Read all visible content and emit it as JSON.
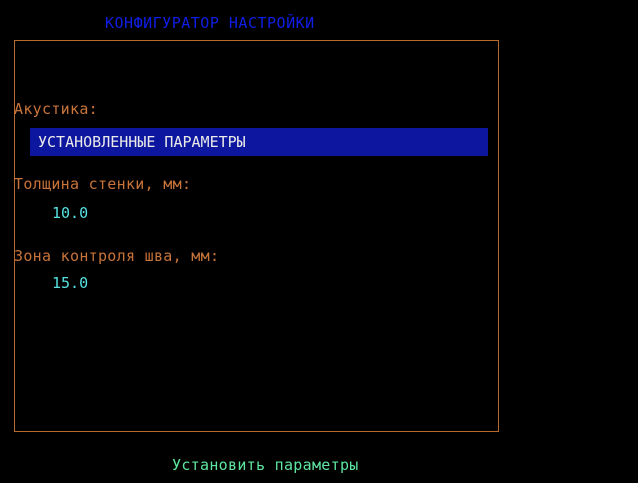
{
  "window": {
    "title": "КОНФИГУРАТОР НАСТРОЙКИ"
  },
  "form": {
    "acoustics": {
      "label": "Акустика:",
      "value": "УСТАНОВЛЕННЫЕ ПАРАМЕТРЫ"
    },
    "wall_thickness": {
      "label": "Толщина стенки, мм:",
      "value": "10.0"
    },
    "seam_zone": {
      "label": "Зона контроля шва, мм:",
      "value": "15.0"
    }
  },
  "footer": {
    "action_label": "Установить параметры"
  },
  "colors": {
    "background": "#000000",
    "title": "#0f1ee6",
    "border": "#b86a2e",
    "label": "#c8743a",
    "selection": "#0d169e",
    "value": "#57e2e2",
    "action": "#5ee6a0"
  }
}
